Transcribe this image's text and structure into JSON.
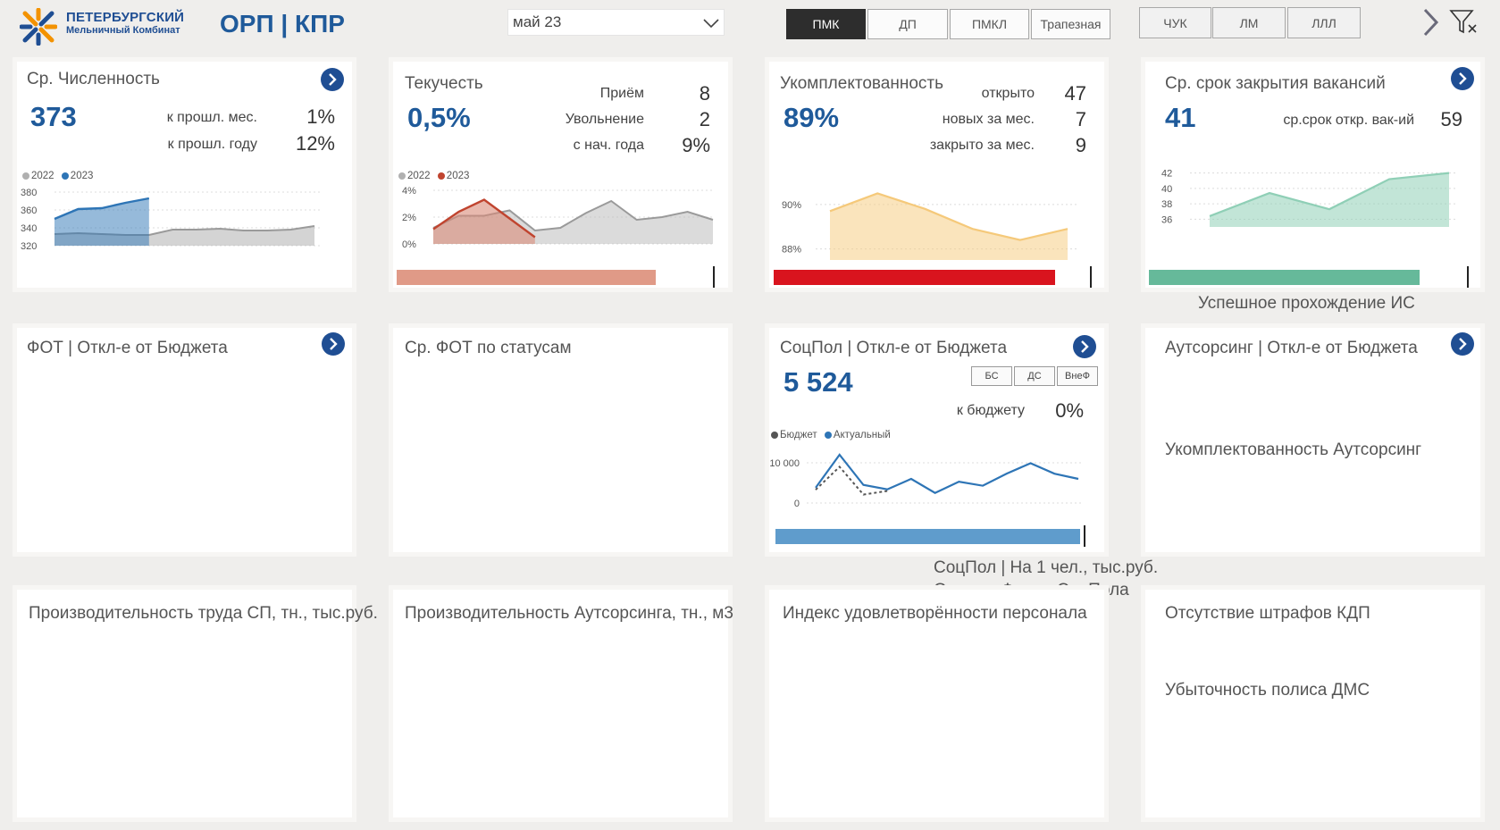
{
  "header": {
    "logo_line1": "ПЕТЕРБУРГСКИЙ",
    "logo_line2": "Мельничный Комбинат",
    "title": "ОРП | КПР",
    "month": "май 23",
    "units": [
      {
        "label": "ПМК",
        "active": true
      },
      {
        "label": "ДП",
        "active": false
      },
      {
        "label": "ПМКЛ",
        "active": false
      },
      {
        "label": "Трапезная",
        "active": false
      }
    ],
    "units2": [
      {
        "label": "ЧУК"
      },
      {
        "label": "ЛМ"
      },
      {
        "label": "ЛЛЛ"
      }
    ]
  },
  "headcount": {
    "title": "Ср. Численность",
    "value": "373",
    "prev_month_label": "к прошл. мес.",
    "prev_month_value": "1%",
    "prev_year_label": "к прошл. году",
    "prev_year_value": "12%",
    "legend": [
      "2022",
      "2023"
    ]
  },
  "turnover": {
    "title": "Текучесть",
    "value": "0,5%",
    "hire_label": "Приём",
    "hire_value": "8",
    "dismiss_label": "Увольнение",
    "dismiss_value": "2",
    "ytd_label": "с нач. года",
    "ytd_value": "9%",
    "legend": [
      "2022",
      "2023"
    ],
    "bar_fraction": 0.84
  },
  "staffing": {
    "title": "Укомплектованность",
    "value": "89%",
    "open_label": "открыто",
    "open_value": "47",
    "new_label": "новых за мес.",
    "new_value": "7",
    "closed_label": "закрыто за мес.",
    "closed_value": "9",
    "bar_fraction": 0.94
  },
  "vacancy": {
    "title": "Ср. срок закрытия вакансий",
    "value": "41",
    "open_label": "ср.срок откр. вак-ий",
    "open_value": "59",
    "bar_fraction": 0.92,
    "below_label": "Успешное прохождение ИС"
  },
  "fot": {
    "title": "ФОТ | Откл-е от Бюджета"
  },
  "fot_status": {
    "title": "Ср. ФОТ по статусам"
  },
  "socpol": {
    "title": "СоцПол | Откл-е от Бюджета",
    "value": "5 524",
    "budget_label": "к бюджету",
    "budget_value": "0%",
    "buttons": [
      "БС",
      "ДС",
      "ВнеФ"
    ],
    "legend": [
      "Бюджет",
      "Актуальный"
    ],
    "bar_fraction": 0.98,
    "below_1": "СоцПол | На 1 чел., тыс.руб.",
    "below_2": "Остаток Фонда СоцПола"
  },
  "outsourcing": {
    "title": "Аутсорсинг | Откл-е от Бюджета",
    "subtitle": "Укомплектованность Аутсорсинг"
  },
  "productivity": {
    "title": "Производительность труда СП, тн., тыс.руб."
  },
  "outsourcing_productivity": {
    "title": "Производительность Аутсорсинга, тн., м3"
  },
  "satisfaction": {
    "title": "Индекс удовлетворённости персонала"
  },
  "kdp": {
    "title": "Отсутствие штрафов КДП",
    "subtitle": "Убыточность полиса ДМС"
  },
  "colors": {
    "brand": "#1f4e93",
    "headcount_2023": "#2e75b6",
    "headcount_2022": "#b0b0b0",
    "turnover_2023": "#c0442f",
    "turnover_bar": "#e09a87",
    "staffing_area": "#f5c97a",
    "staffing_bar": "#d9141e",
    "vacancy_area": "#8fcfb6",
    "vacancy_bar": "#66b99a",
    "socpol_line": "#2e75b6",
    "socpol_bar": "#5f9ccc"
  },
  "chart_data": [
    {
      "type": "area",
      "ylim": [
        320,
        380
      ],
      "yticks": [
        "380",
        "360",
        "340",
        "320"
      ],
      "x": [
        1,
        2,
        3,
        4,
        5,
        6,
        7,
        8,
        9,
        10,
        11,
        12
      ],
      "series": [
        {
          "name": "2022",
          "values": [
            333,
            334,
            333,
            332,
            332,
            338,
            338,
            339,
            337,
            337,
            338,
            342
          ]
        },
        {
          "name": "2023",
          "values": [
            350,
            361,
            362,
            368,
            373
          ]
        }
      ]
    },
    {
      "type": "area",
      "ylim": [
        0,
        4
      ],
      "yticks": [
        "4%",
        "2%",
        "0%"
      ],
      "x": [
        1,
        2,
        3,
        4,
        5,
        6,
        7,
        8,
        9,
        10,
        11,
        12
      ],
      "series": [
        {
          "name": "2022",
          "values": [
            1.2,
            2.1,
            2.1,
            2.5,
            1.0,
            1.2,
            2.3,
            3.2,
            1.8,
            2.0,
            2.4,
            1.8
          ]
        },
        {
          "name": "2023",
          "values": [
            1.1,
            2.4,
            3.3,
            1.9,
            0.5
          ]
        }
      ]
    },
    {
      "type": "area",
      "ylim": [
        87.5,
        91
      ],
      "yticks": [
        "90%",
        "88%"
      ],
      "x": [
        1,
        2,
        3,
        4,
        5,
        6
      ],
      "series": [
        {
          "values": [
            89.7,
            90.5,
            89.8,
            88.9,
            88.4,
            88.9
          ]
        }
      ]
    },
    {
      "type": "area",
      "ylim": [
        35,
        43
      ],
      "yticks": [
        "42",
        "40",
        "38",
        "36"
      ],
      "x": [
        1,
        2,
        3,
        4,
        5
      ],
      "series": [
        {
          "values": [
            36.4,
            39.4,
            37.3,
            41.2,
            42
          ]
        }
      ]
    },
    {
      "type": "line",
      "ylim": [
        -2000,
        14000
      ],
      "yticks": [
        "10 000",
        "0"
      ],
      "x": [
        1,
        2,
        3,
        4,
        5,
        6,
        7,
        8,
        9,
        10,
        11,
        12
      ],
      "series": [
        {
          "name": "Бюджет",
          "values": [
            3300,
            9000,
            2100,
            3000
          ]
        },
        {
          "name": "Актуальный",
          "values": [
            3800,
            12000,
            4500,
            3400,
            6000,
            2500,
            5300,
            4300,
            7300,
            9900,
            7300,
            6000
          ]
        }
      ]
    }
  ]
}
